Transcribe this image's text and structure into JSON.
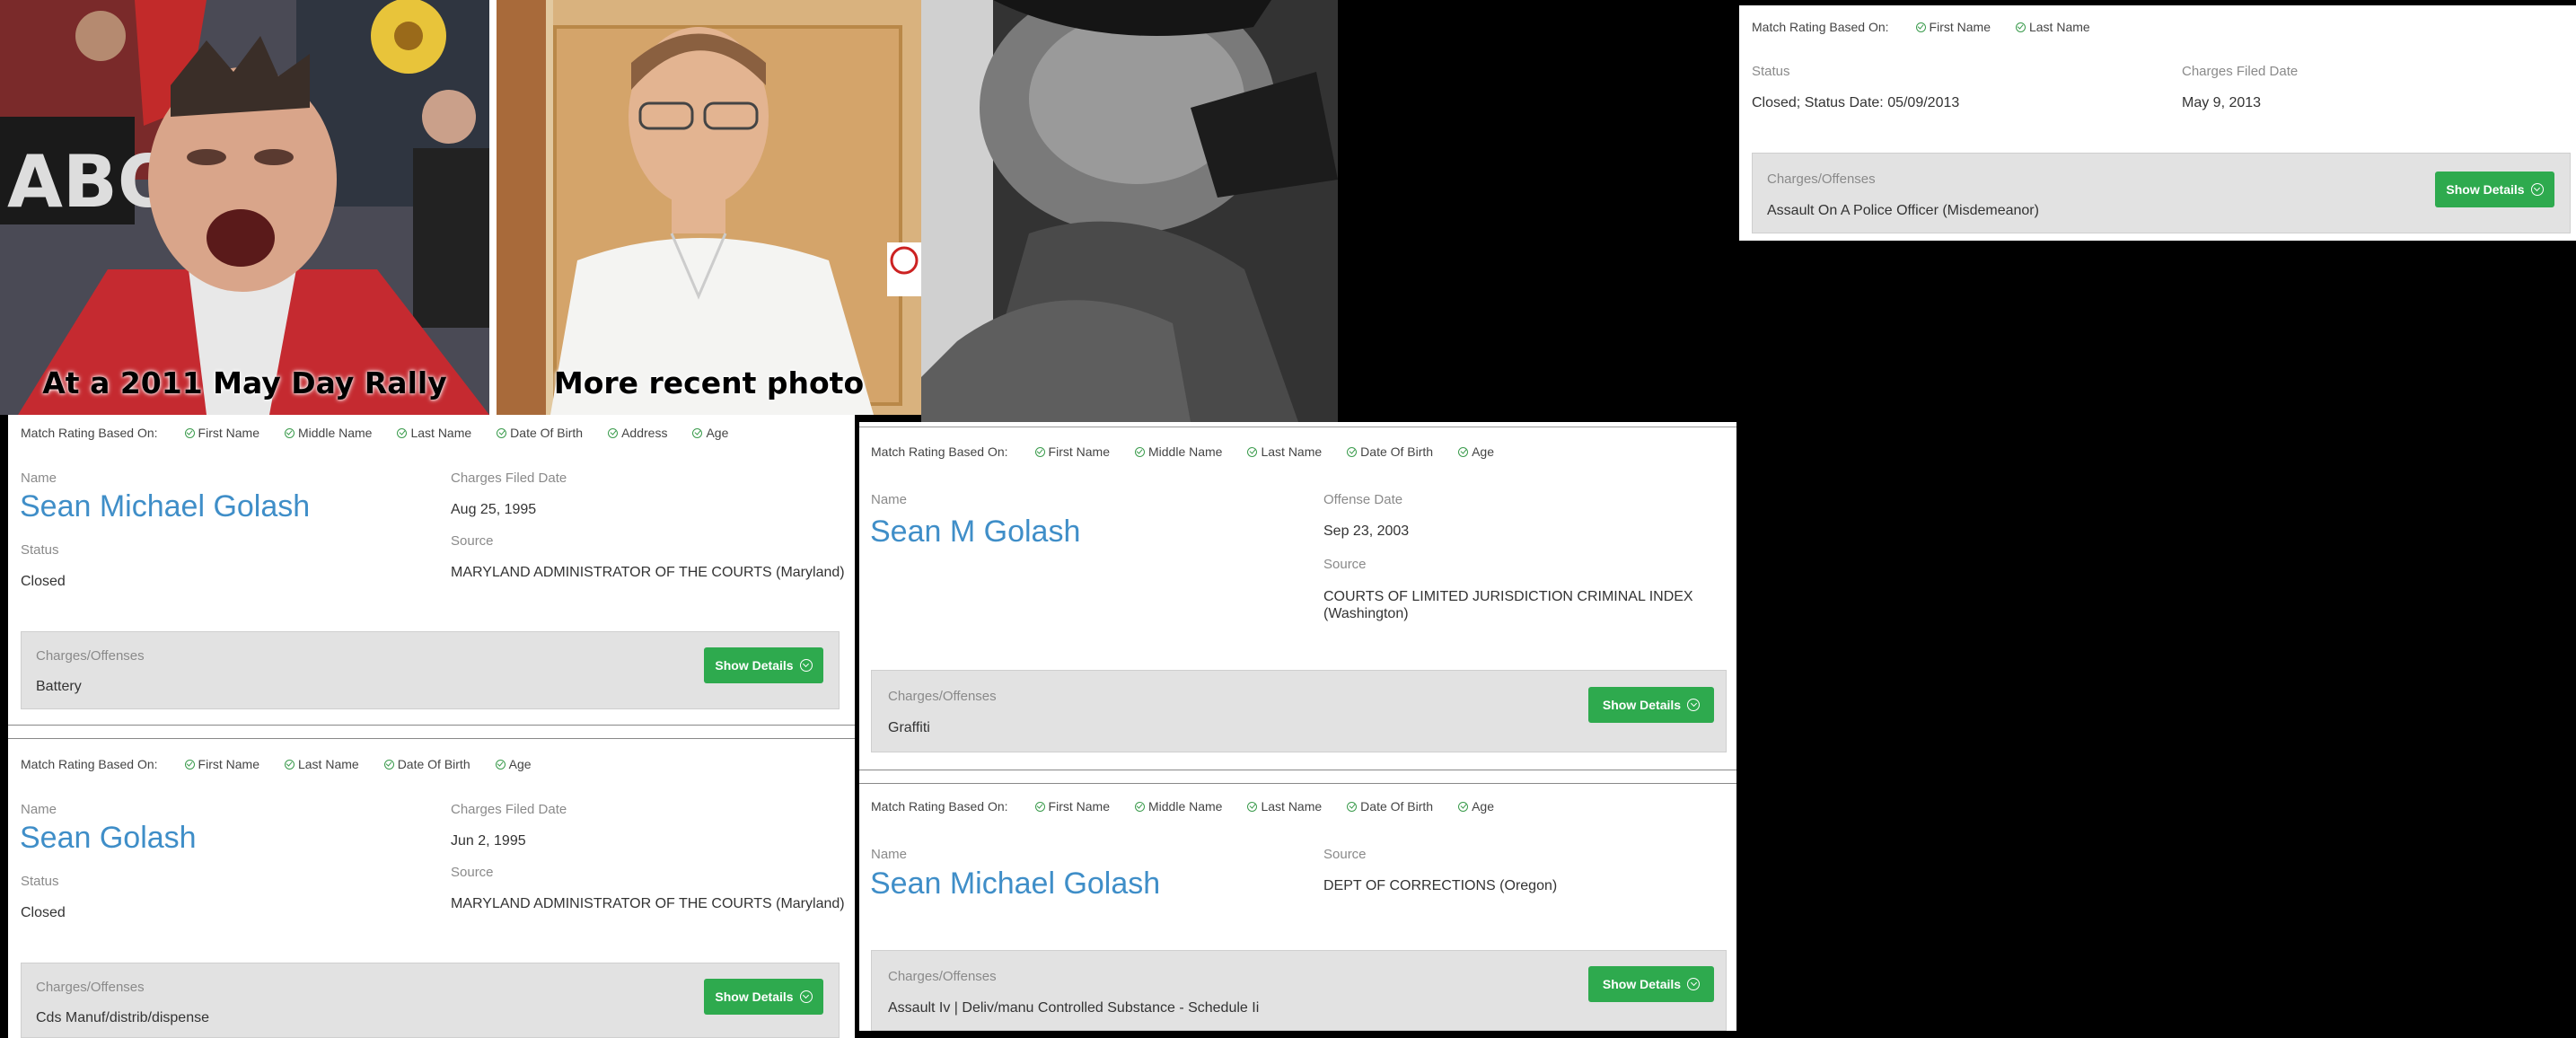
{
  "photos": {
    "rally_caption": "At a 2011 May Day Rally",
    "recent_caption": "More recent photo"
  },
  "records": {
    "topright": {
      "match_label": "Match Rating Based On:",
      "criteria": [
        "First Name",
        "Last Name"
      ],
      "status_label": "Status",
      "status_value": "Closed; Status Date: 05/09/2013",
      "filed_label": "Charges Filed Date",
      "filed_value": "May 9, 2013",
      "charges_label": "Charges/Offenses",
      "charges_value": "Assault On A Police Officer (Misdemeanor)",
      "button": "Show Details"
    },
    "left1": {
      "match_label": "Match Rating Based On:",
      "criteria": [
        "First Name",
        "Middle Name",
        "Last Name",
        "Date Of Birth",
        "Address",
        "Age"
      ],
      "name_label": "Name",
      "name_value": "Sean Michael Golash",
      "status_label": "Status",
      "status_value": "Closed",
      "filed_label": "Charges Filed Date",
      "filed_value": "Aug 25, 1995",
      "source_label": "Source",
      "source_value": "MARYLAND ADMINISTRATOR OF THE COURTS (Maryland)",
      "charges_label": "Charges/Offenses",
      "charges_value": "Battery",
      "button": "Show Details"
    },
    "left2": {
      "match_label": "Match Rating Based On:",
      "criteria": [
        "First Name",
        "Last Name",
        "Date Of Birth",
        "Age"
      ],
      "name_label": "Name",
      "name_value": "Sean Golash",
      "status_label": "Status",
      "status_value": "Closed",
      "filed_label": "Charges Filed Date",
      "filed_value": "Jun 2, 1995",
      "source_label": "Source",
      "source_value": "MARYLAND ADMINISTRATOR OF THE COURTS (Maryland)",
      "charges_label": "Charges/Offenses",
      "charges_value": "Cds Manuf/distrib/dispense",
      "button": "Show Details"
    },
    "mid1": {
      "match_label": "Match Rating Based On:",
      "criteria": [
        "First Name",
        "Middle Name",
        "Last Name",
        "Date Of Birth",
        "Age"
      ],
      "name_label": "Name",
      "name_value": "Sean M Golash",
      "offense_label": "Offense Date",
      "offense_value": "Sep 23, 2003",
      "source_label": "Source",
      "source_value": "COURTS OF LIMITED JURISDICTION CRIMINAL INDEX (Washington)",
      "charges_label": "Charges/Offenses",
      "charges_value": "Graffiti",
      "button": "Show Details"
    },
    "mid2": {
      "match_label": "Match Rating Based On:",
      "criteria": [
        "First Name",
        "Middle Name",
        "Last Name",
        "Date Of Birth",
        "Age"
      ],
      "name_label": "Name",
      "name_value": "Sean Michael Golash",
      "source_label": "Source",
      "source_value": "DEPT OF CORRECTIONS (Oregon)",
      "charges_label": "Charges/Offenses",
      "charges_value": "Assault Iv | Deliv/manu Controlled Substance - Schedule Ii",
      "button": "Show Details"
    }
  }
}
